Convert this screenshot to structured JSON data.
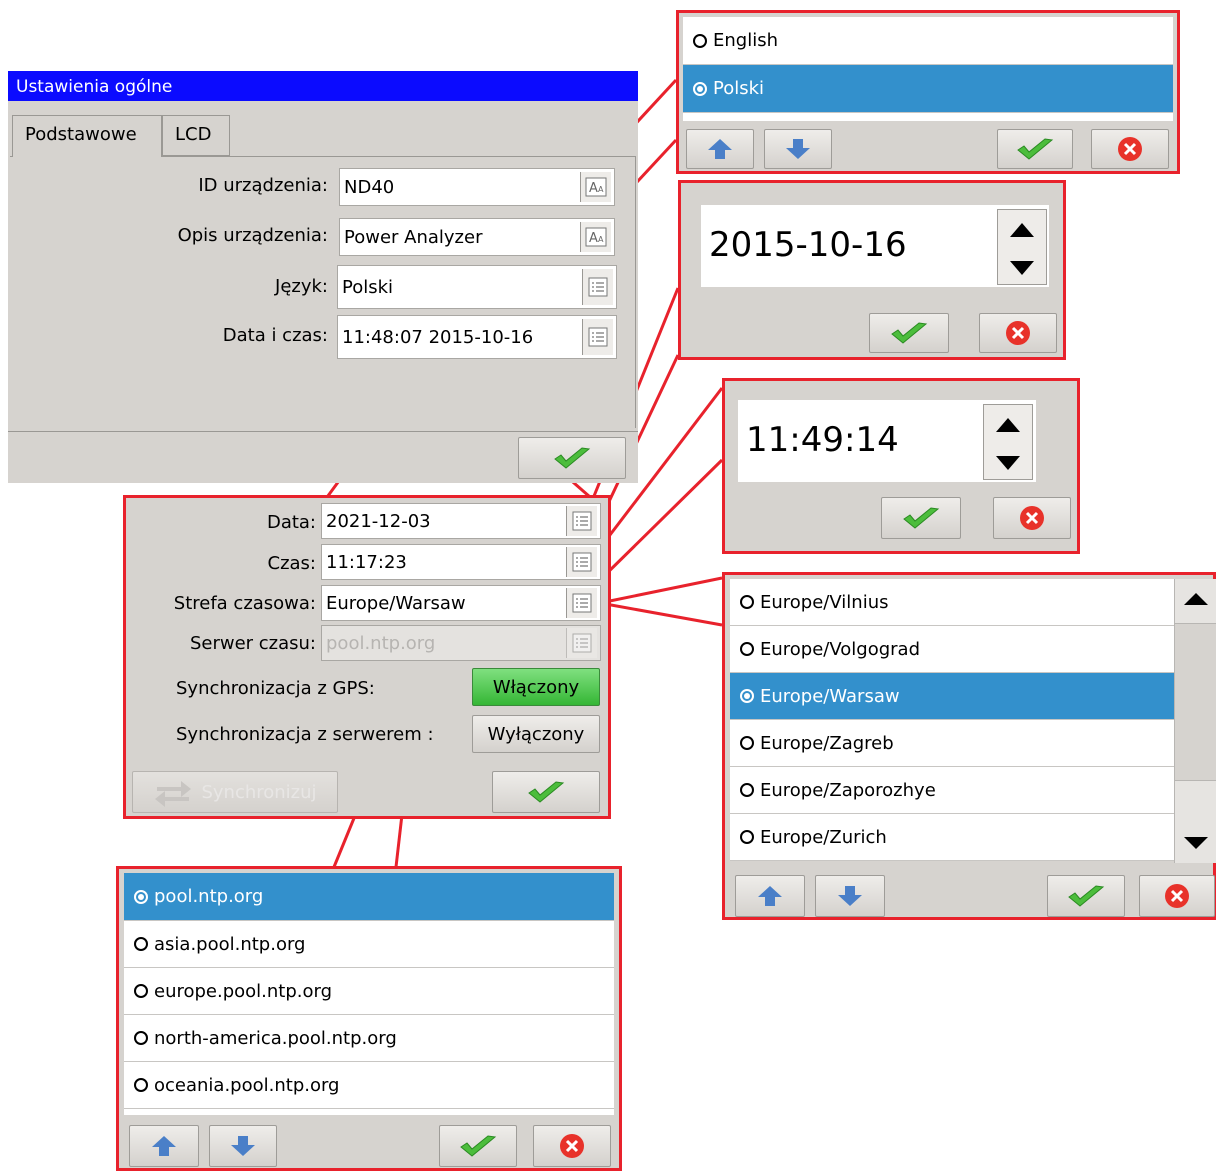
{
  "main": {
    "title": "Ustawienia ogólne",
    "tabs": [
      "Podstawowe",
      "LCD"
    ],
    "fields": [
      {
        "label": "ID urządzenia:",
        "value": "ND40"
      },
      {
        "label": "Opis urządzenia:",
        "value": "Power Analyzer"
      },
      {
        "label": "Język:",
        "value": "Polski"
      },
      {
        "label": "Data i czas:",
        "value": "11:48:07 2015-10-16"
      }
    ]
  },
  "datetime": {
    "fields": [
      {
        "label": "Data:",
        "value": "2021-12-03"
      },
      {
        "label": "Czas:",
        "value": "11:17:23"
      },
      {
        "label": "Strefa czasowa:",
        "value": "Europe/Warsaw"
      },
      {
        "label": "Serwer czasu:",
        "value": "pool.ntp.org"
      }
    ],
    "gps_label": "Synchronizacja z GPS:",
    "gps_value": "Włączony",
    "server_label": "Synchronizacja z serwerem :",
    "server_value": "Wyłączony",
    "sync_button": "Synchronizuj"
  },
  "language_list": {
    "items": [
      "English",
      "Polski"
    ],
    "selected": "Polski"
  },
  "date_editor": {
    "value": "2015-10-16"
  },
  "time_editor": {
    "value": "11:49:14"
  },
  "timezone_list": {
    "items": [
      "Europe/Vilnius",
      "Europe/Volgograd",
      "Europe/Warsaw",
      "Europe/Zagreb",
      "Europe/Zaporozhye",
      "Europe/Zurich"
    ],
    "selected": "Europe/Warsaw"
  },
  "ntp_list": {
    "items": [
      "pool.ntp.org",
      "asia.pool.ntp.org",
      "europe.pool.ntp.org",
      "north-america.pool.ntp.org",
      "oceania.pool.ntp.org"
    ],
    "selected": "pool.ntp.org"
  },
  "colors": {
    "highlight": "#e8222c",
    "selection": "#3390cc",
    "titlebar": "#0b0bff"
  }
}
